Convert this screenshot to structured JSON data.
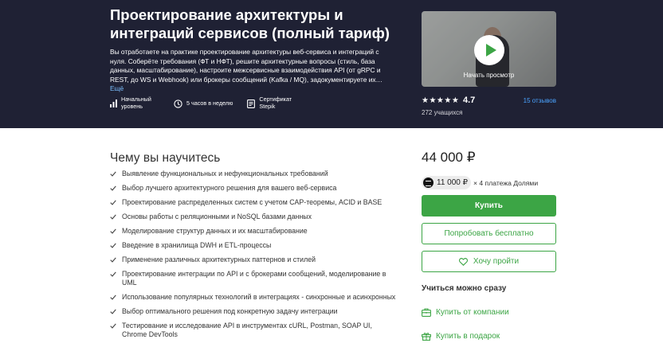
{
  "hero": {
    "title": "Проектирование архитектуры и интеграций сервисов (полный тариф)",
    "description": "Вы отработаете на практике проектирование архитектуры веб-сервиса и интеграций с нуля. Соберёте требования (ФТ и НФТ), решите архитектурные вопросы (стиль, база данных, масштабирование), настроите межсервисные взаимодействия API (от gRPC и REST, до WS и Webhook) или брокеры сообщений (Kafka / MQ), задокументируете их…",
    "more_link": "Ещё",
    "meta": [
      {
        "icon": "level-bars-icon",
        "label": "Начальный уровень"
      },
      {
        "icon": "clock-icon",
        "label": "5 часов в неделю"
      },
      {
        "icon": "certificate-icon",
        "label": "Сертификат Stepik"
      }
    ]
  },
  "preview": {
    "label": "Начать просмотр"
  },
  "rating": {
    "stars": "★★★★★",
    "value": "4.7",
    "reviews": "15 отзывов",
    "students": "272 учащихся"
  },
  "learn": {
    "title": "Чему вы научитесь",
    "items": [
      "Выявление функциональных и нефункциональных требований",
      "Выбор лучшего архитектурного решения для вашего веб-сервиса",
      "Проектирование распределенных систем с учетом CAP-теоремы, ACID и BASE",
      "Основы работы с реляционными и NoSQL базами данных",
      "Моделирование структур данных и их масштабирование",
      "Введение в хранилища DWH и ETL-процессы",
      "Применение различных архитектурных паттернов и стилей",
      "Проектирование интеграции по API и с брокерами сообщений, моделирование в UML",
      "Использование популярных технологий в интеграциях - синхронные и асинхронных",
      "Выбор оптимального решения под конкретную задачу интеграции",
      "Тестирование и исследование API в инструментах cURL, Postman, SOAP UI, Chrome DevTools"
    ]
  },
  "purchase": {
    "price": "44 000 ₽",
    "installment_amount": "11 000 ₽",
    "installment_text": "× 4 платежа Долями",
    "buy": "Купить",
    "try_free": "Попробовать бесплатно",
    "wishlist": "Хочу пройти",
    "learn_now_title": "Учиться можно сразу",
    "buy_company": "Купить от компании",
    "buy_gift": "Купить в подарок"
  },
  "colors": {
    "hero_bg": "#1f2134",
    "accent": "#3ca545",
    "link": "#4aa3ff"
  }
}
